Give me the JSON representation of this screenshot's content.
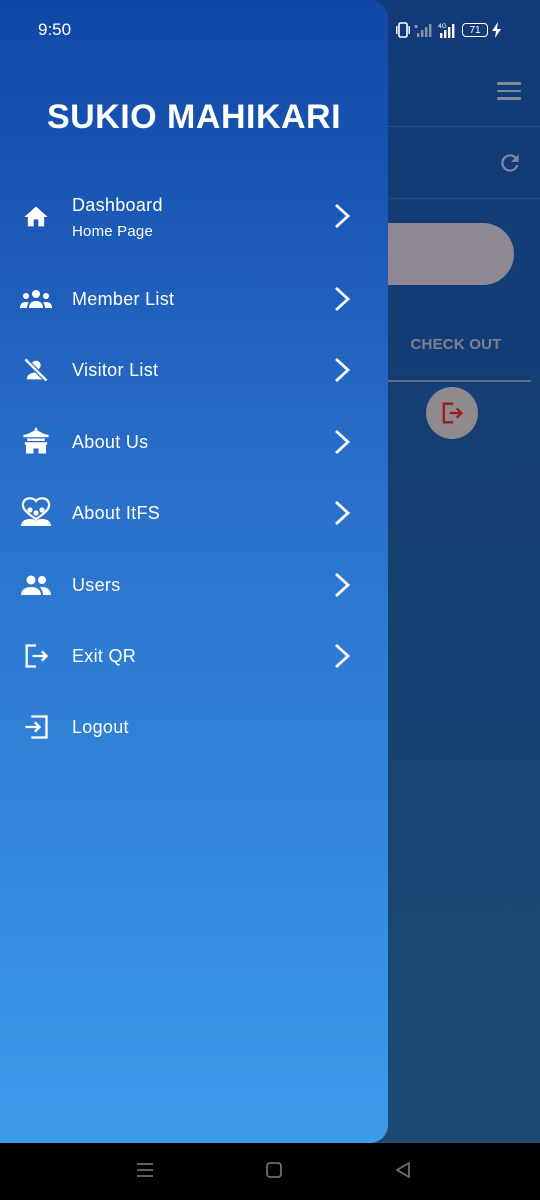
{
  "status_bar": {
    "time": "9:50",
    "network": "4G",
    "battery": "71"
  },
  "background_app": {
    "checkout_label": "CHECK OUT"
  },
  "drawer": {
    "title": "SUKIO MAHIKARI",
    "items": [
      {
        "label": "Dashboard",
        "sublabel": "Home Page",
        "icon": "home-icon",
        "chevron": true
      },
      {
        "label": "Member List",
        "icon": "group-icon",
        "chevron": true
      },
      {
        "label": "Visitor List",
        "icon": "person-off-icon",
        "chevron": true
      },
      {
        "label": "About Us",
        "icon": "temple-icon",
        "chevron": true
      },
      {
        "label": "About ItFS",
        "icon": "diversity-icon",
        "chevron": true
      },
      {
        "label": "Users",
        "icon": "people-icon",
        "chevron": true
      },
      {
        "label": "Exit QR",
        "icon": "exit-icon",
        "chevron": true
      },
      {
        "label": "Logout",
        "icon": "logout-icon",
        "chevron": false
      }
    ]
  },
  "colors": {
    "drawer_top": "#1147a6",
    "drawer_bottom": "#3d9bea",
    "background_app": "#123a78",
    "exit_icon_red": "#a01c1c"
  }
}
